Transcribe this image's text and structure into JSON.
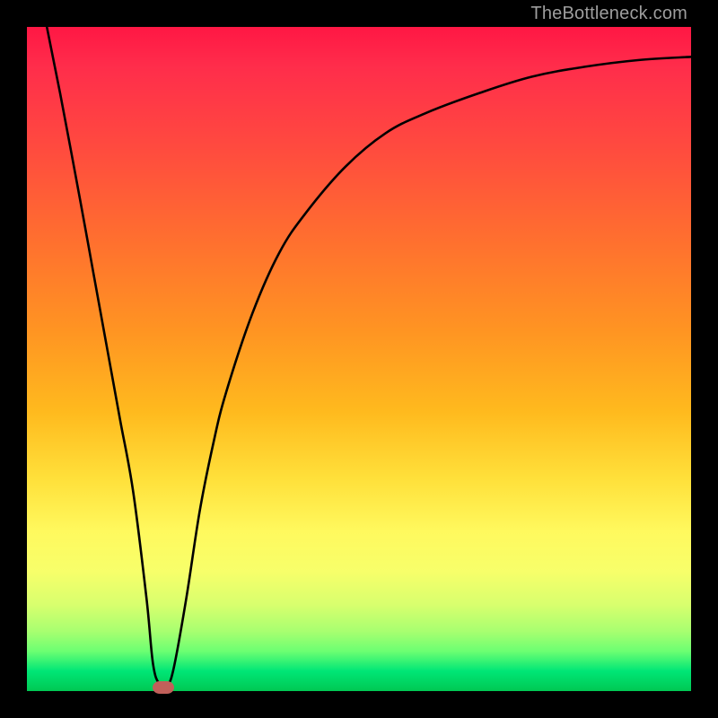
{
  "watermark": "TheBottleneck.com",
  "colors": {
    "frame": "#000000",
    "watermark": "#9e9e9e",
    "curve": "#000000",
    "marker": "#c1605a",
    "gradient_stops": [
      "#ff1744",
      "#ff2d4b",
      "#ff4a3f",
      "#ff6f2f",
      "#ff9522",
      "#ffba1e",
      "#ffe03a",
      "#fff95e",
      "#f7ff6a",
      "#d8ff6e",
      "#a8ff70",
      "#6cff72",
      "#00e676",
      "#00c853"
    ]
  },
  "chart_data": {
    "type": "line",
    "title": "",
    "xlabel": "",
    "ylabel": "",
    "xlim": [
      0,
      100
    ],
    "ylim": [
      0,
      100
    ],
    "grid": false,
    "legend": false,
    "series": [
      {
        "name": "bottleneck-curve",
        "x": [
          3,
          5,
          8,
          10,
          12,
          14,
          16,
          18,
          19,
          20,
          21,
          22,
          24,
          26,
          28,
          30,
          34,
          38,
          42,
          48,
          54,
          60,
          68,
          76,
          84,
          92,
          100
        ],
        "y": [
          100,
          90,
          74,
          63,
          52,
          41,
          30,
          14,
          4,
          1,
          1,
          3,
          14,
          27,
          37,
          45,
          57,
          66,
          72,
          79,
          84,
          87,
          90,
          92.5,
          94,
          95,
          95.5
        ]
      }
    ],
    "annotations": [
      {
        "name": "min-marker",
        "x": 20.5,
        "y": 0.5
      }
    ],
    "notes": "x and y are in percent of plot width/height (0 = left/bottom, 100 = right/top). Values estimated from pixels; curve has a sharp V minimum near x≈20 then rises asymptotically."
  }
}
